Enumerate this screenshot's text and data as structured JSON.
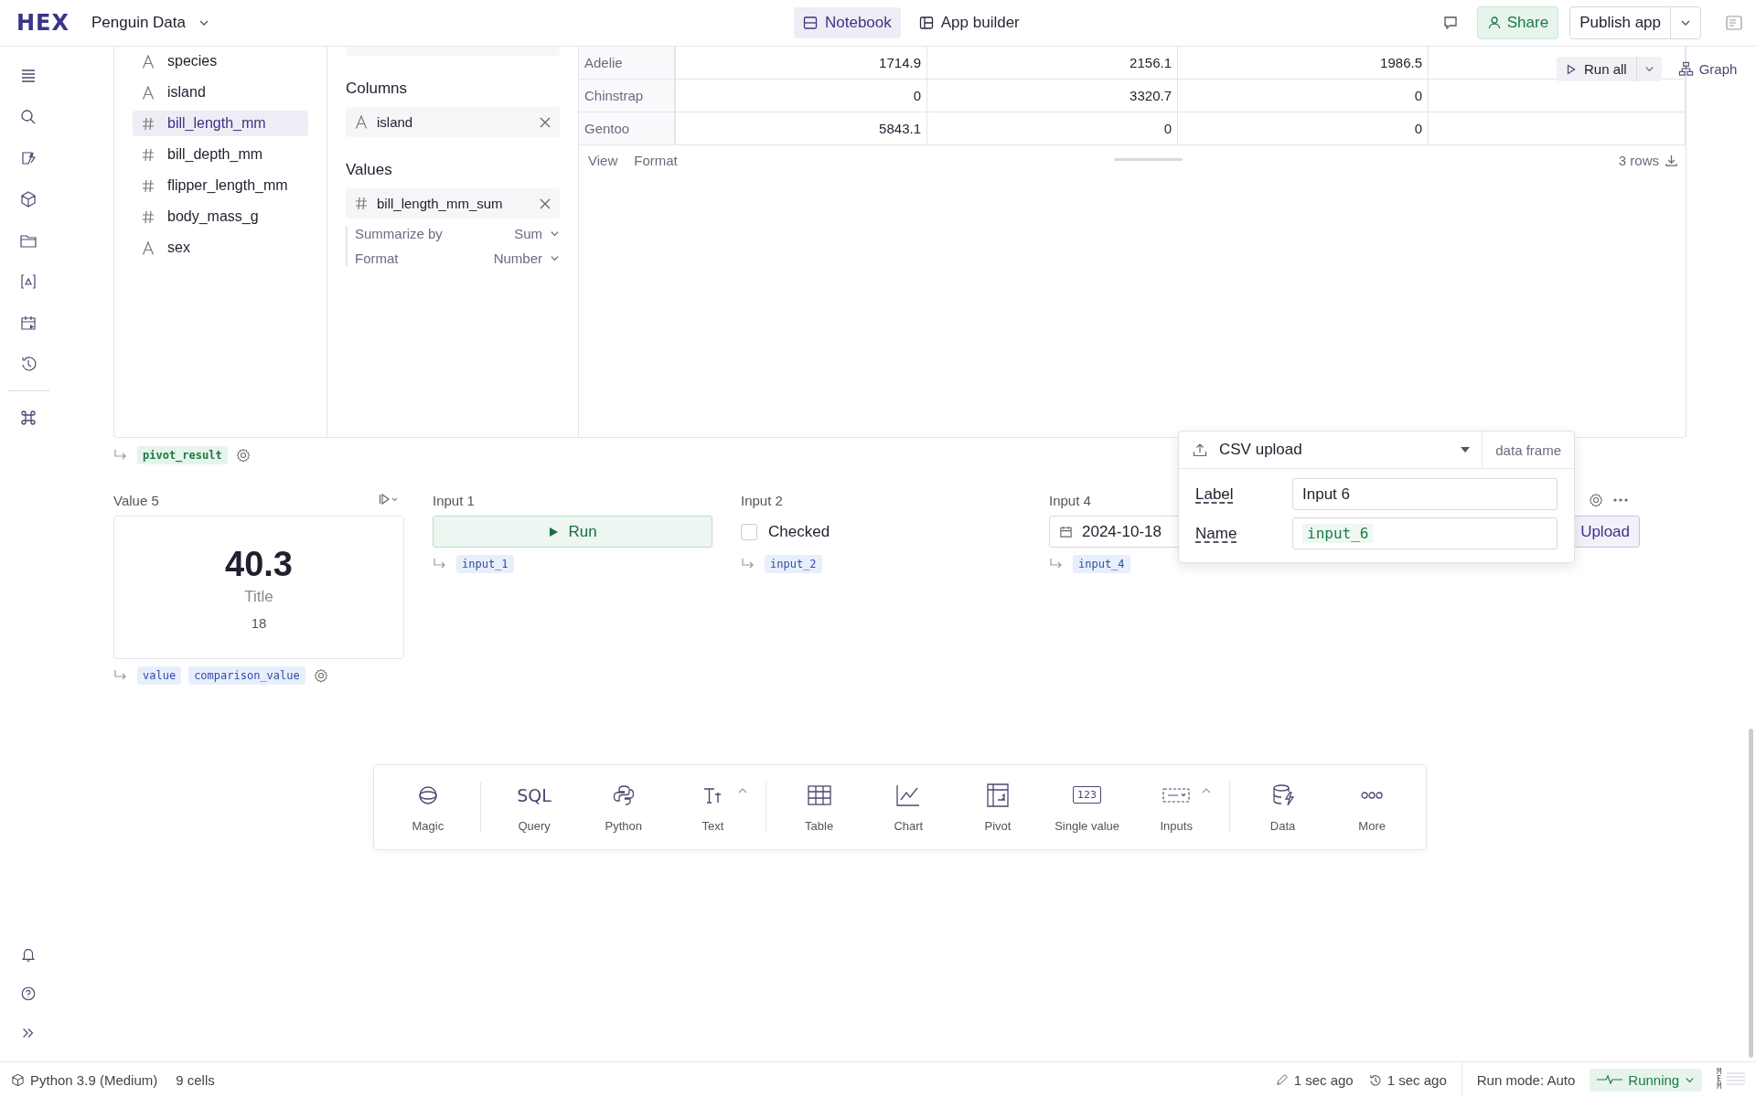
{
  "header": {
    "logo": "HEX",
    "project": "Penguin Data",
    "tabs": [
      {
        "label": "Notebook",
        "kind": "notebook",
        "selected": true
      },
      {
        "label": "App builder",
        "kind": "builder",
        "selected": false
      }
    ],
    "share": "Share",
    "publish": "Publish app"
  },
  "fields": [
    {
      "name": "species",
      "kind": "text",
      "selected": false
    },
    {
      "name": "island",
      "kind": "text",
      "selected": false
    },
    {
      "name": "bill_length_mm",
      "kind": "number",
      "selected": true
    },
    {
      "name": "bill_depth_mm",
      "kind": "number",
      "selected": false
    },
    {
      "name": "flipper_length_mm",
      "kind": "number",
      "selected": false
    },
    {
      "name": "body_mass_g",
      "kind": "number",
      "selected": false
    },
    {
      "name": "sex",
      "kind": "text",
      "selected": false
    }
  ],
  "pivot_config": {
    "columns_heading": "Columns",
    "columns": [
      {
        "name": "island",
        "kind": "text"
      }
    ],
    "values_heading": "Values",
    "values": [
      {
        "name": "bill_length_mm_sum",
        "kind": "number"
      }
    ],
    "options": [
      {
        "label": "Summarize by",
        "value": "Sum"
      },
      {
        "label": "Format",
        "value": "Number"
      }
    ]
  },
  "table": {
    "rows": [
      {
        "label": "Adelie",
        "cells": [
          "1714.9",
          "2156.1",
          "1986.5"
        ]
      },
      {
        "label": "Chinstrap",
        "cells": [
          "0",
          "3320.7",
          "0"
        ]
      },
      {
        "label": "Gentoo",
        "cells": [
          "5843.1",
          "0",
          "0"
        ]
      }
    ],
    "footer": [
      "View",
      "Format"
    ],
    "row_count": "3 rows"
  },
  "run_all": "Run all",
  "graph": "Graph",
  "pivot_output": "pivot_result",
  "value_cell": {
    "label": "Value 5",
    "value": "40.3",
    "title": "Title",
    "comparison": "18",
    "outputs": [
      "value",
      "comparison_value"
    ]
  },
  "inputs": [
    {
      "label": "Input 1",
      "kind": "button",
      "text": "Run",
      "output": "input_1"
    },
    {
      "label": "Input 2",
      "kind": "checkbox",
      "text": "Checked",
      "checked": false,
      "output": "input_2"
    },
    {
      "label": "Input 4",
      "kind": "date",
      "text": "2024-10-18",
      "output": "input_4"
    }
  ],
  "upload_button": "Upload",
  "popover": {
    "type": "CSV upload",
    "output_type": "data frame",
    "fields": [
      {
        "label": "Label",
        "value": "Input 6",
        "kind": "text"
      },
      {
        "label": "Name",
        "value": "input_6",
        "kind": "code"
      }
    ]
  },
  "toolbar": {
    "groups": [
      [
        {
          "label": "Magic",
          "kind": "magic",
          "has_menu": false
        }
      ],
      [
        {
          "label": "Query",
          "kind": "sql",
          "glyph": "SQL",
          "has_menu": false
        },
        {
          "label": "Python",
          "kind": "python",
          "has_menu": false
        },
        {
          "label": "Text",
          "kind": "text",
          "has_menu": true
        }
      ],
      [
        {
          "label": "Table",
          "kind": "table",
          "has_menu": false
        },
        {
          "label": "Chart",
          "kind": "chart",
          "has_menu": false
        },
        {
          "label": "Pivot",
          "kind": "pivot",
          "has_menu": false
        },
        {
          "label": "Single value",
          "kind": "single",
          "glyph": "123",
          "has_menu": false
        },
        {
          "label": "Inputs",
          "kind": "inputs",
          "has_menu": true
        }
      ],
      [
        {
          "label": "Data",
          "kind": "data",
          "has_menu": false
        },
        {
          "label": "More",
          "kind": "more",
          "has_menu": false
        }
      ]
    ]
  },
  "status": {
    "kernel": "Python 3.9 (Medium)",
    "cells": "9 cells",
    "edited": "1 sec ago",
    "ran": "1 sec ago",
    "run_mode": "Run mode: Auto",
    "state": "Running",
    "mem": "MEM"
  }
}
